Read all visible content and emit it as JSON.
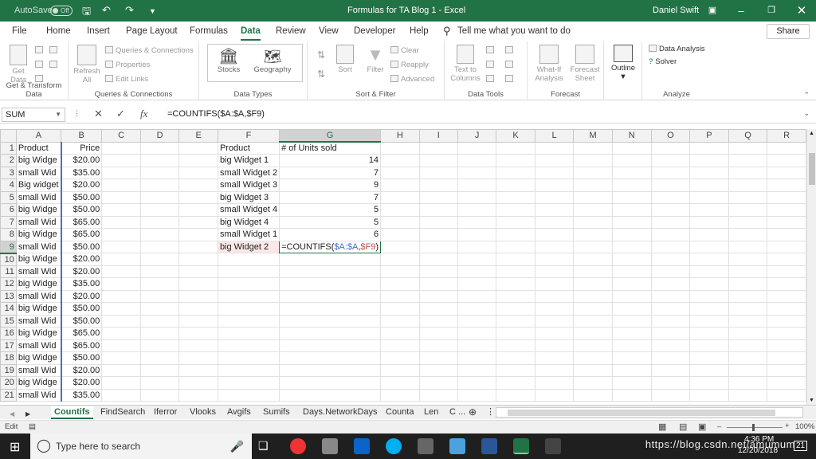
{
  "titlebar": {
    "autosave": "AutoSave",
    "toggle": "Off",
    "title": "Formulas for TA Blog 1  -  Excel",
    "user": "Daniel Swift"
  },
  "ribbon_tabs": [
    "File",
    "Home",
    "Insert",
    "Page Layout",
    "Formulas",
    "Data",
    "Review",
    "View",
    "Developer",
    "Help"
  ],
  "active_tab": "Data",
  "tell_me": "Tell me what you want to do",
  "share": "Share",
  "ribbon": {
    "get_data": [
      "Get",
      "Data"
    ],
    "refresh": [
      "Refresh",
      "All"
    ],
    "queries": "Queries & Connections",
    "properties": "Properties",
    "edit_links": "Edit Links",
    "stocks": "Stocks",
    "geography": "Geography",
    "sort": "Sort",
    "filter": "Filter",
    "clear": "Clear",
    "reapply": "Reapply",
    "advanced": "Advanced",
    "text_to_columns": [
      "Text to",
      "Columns"
    ],
    "what_if": [
      "What-If",
      "Analysis"
    ],
    "forecast_sheet": [
      "Forecast",
      "Sheet"
    ],
    "outline": "Outline",
    "data_analysis": "Data Analysis",
    "solver": "Solver",
    "groups": [
      "Get & Transform Data",
      "Queries & Connections",
      "Data Types",
      "Sort & Filter",
      "Data Tools",
      "Forecast",
      "Analyze"
    ]
  },
  "formula_bar": {
    "namebox": "SUM",
    "fx": "fx",
    "formula": "=COUNTIFS($A:$A,$F9)"
  },
  "columns": [
    "A",
    "B",
    "C",
    "D",
    "E",
    "F",
    "G",
    "H",
    "I",
    "J",
    "K",
    "L",
    "M",
    "N",
    "O",
    "P",
    "Q",
    "R"
  ],
  "rows": [
    {
      "n": "1",
      "A": "Product",
      "B": "Price",
      "F": "Product",
      "G": "# of Units sold"
    },
    {
      "n": "2",
      "A": "big Widge",
      "B": "$20.00",
      "F": "big Widget 1",
      "G": "14"
    },
    {
      "n": "3",
      "A": "small Wid",
      "B": "$35.00",
      "F": "small Widget 2",
      "G": "7"
    },
    {
      "n": "4",
      "A": "Big widget",
      "B": "$20.00",
      "F": "small Widget 3",
      "G": "9"
    },
    {
      "n": "5",
      "A": "small Wid",
      "B": "$50.00",
      "F": "big Widget 3",
      "G": "7"
    },
    {
      "n": "6",
      "A": "big Widge",
      "B": "$50.00",
      "F": "small Widget 4",
      "G": "5"
    },
    {
      "n": "7",
      "A": "small Wid",
      "B": "$65.00",
      "F": "big Widget 4",
      "G": "5"
    },
    {
      "n": "8",
      "A": "big Widge",
      "B": "$65.00",
      "F": "small Widget 1",
      "G": "6"
    },
    {
      "n": "9",
      "A": "small Wid",
      "B": "$50.00",
      "F": "big Widget 2",
      "G": ""
    },
    {
      "n": "10",
      "A": "big Widge",
      "B": "$20.00"
    },
    {
      "n": "11",
      "A": "small Wid",
      "B": "$20.00"
    },
    {
      "n": "12",
      "A": "big Widge",
      "B": "$35.00"
    },
    {
      "n": "13",
      "A": "small Wid",
      "B": "$20.00"
    },
    {
      "n": "14",
      "A": "big Widge",
      "B": "$50.00"
    },
    {
      "n": "15",
      "A": "small Wid",
      "B": "$50.00"
    },
    {
      "n": "16",
      "A": "big Widge",
      "B": "$65.00"
    },
    {
      "n": "17",
      "A": "small Wid",
      "B": "$65.00"
    },
    {
      "n": "18",
      "A": "big Widge",
      "B": "$50.00"
    },
    {
      "n": "19",
      "A": "small Wid",
      "B": "$20.00"
    },
    {
      "n": "20",
      "A": "big Widge",
      "B": "$20.00"
    },
    {
      "n": "21",
      "A": "small Wid",
      "B": "$35.00"
    }
  ],
  "editing_cell": {
    "pre": "=COUNTIFS(",
    "ref1": "$A:$A",
    "sep": ",",
    "ref2": "$F9",
    "post": ")"
  },
  "sheet_tabs": [
    "Countifs",
    "FindSearch",
    "Iferror",
    "Vlooks",
    "Avgifs",
    "Sumifs",
    "Days.NetworkDays",
    "Counta",
    "Len"
  ],
  "active_sheet": "Countifs",
  "status": {
    "mode": "Edit",
    "zoom": "100%"
  },
  "taskbar": {
    "search": "Type here to search",
    "time": "4:36 PM",
    "date": "12/20/2018",
    "notif": "21"
  },
  "watermark": "https://blog.csdn.net/amumum",
  "colors": {
    "excel_green": "#217346",
    "ref_blue": "#4472c4",
    "ref_red": "#c0504d"
  }
}
